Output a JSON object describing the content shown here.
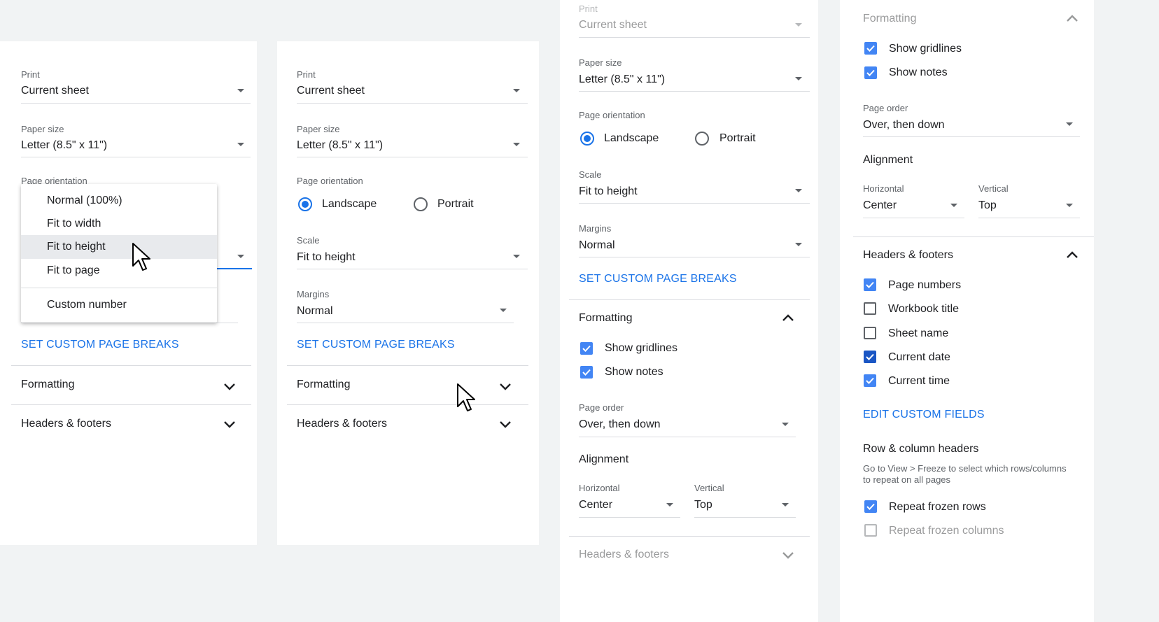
{
  "panel1": {
    "print_label": "Print",
    "print_value": "Current sheet",
    "paper_label": "Paper size",
    "paper_value": "Letter (8.5\" x 11\")",
    "orientation_label": "Page orientation",
    "scale_menu": {
      "items": [
        "Normal (100%)",
        "Fit to width",
        "Fit to height",
        "Fit to page",
        "Custom number"
      ],
      "highlighted": "Fit to height"
    },
    "set_breaks": "SET CUSTOM PAGE BREAKS",
    "formatting": "Formatting",
    "headers_footers": "Headers & footers"
  },
  "panel2": {
    "print_label": "Print",
    "print_value": "Current sheet",
    "paper_label": "Paper size",
    "paper_value": "Letter (8.5\" x 11\")",
    "orientation_label": "Page orientation",
    "landscape": "Landscape",
    "portrait": "Portrait",
    "scale_label": "Scale",
    "scale_value": "Fit to height",
    "margins_label": "Margins",
    "margins_value": "Normal",
    "set_breaks": "SET CUSTOM PAGE BREAKS",
    "formatting": "Formatting",
    "headers_footers": "Headers & footers"
  },
  "panel3": {
    "print_label": "Print",
    "print_value": "Current sheet",
    "paper_label": "Paper size",
    "paper_value": "Letter (8.5\" x 11\")",
    "orientation_label": "Page orientation",
    "landscape": "Landscape",
    "portrait": "Portrait",
    "scale_label": "Scale",
    "scale_value": "Fit to height",
    "margins_label": "Margins",
    "margins_value": "Normal",
    "set_breaks": "SET CUSTOM PAGE BREAKS",
    "formatting": "Formatting",
    "show_gridlines": "Show gridlines",
    "show_notes": "Show notes",
    "page_order_label": "Page order",
    "page_order_value": "Over, then down",
    "alignment": "Alignment",
    "horizontal_label": "Horizontal",
    "horizontal_value": "Center",
    "vertical_label": "Vertical",
    "vertical_value": "Top",
    "headers_footers": "Headers & footers"
  },
  "panel4": {
    "formatting": "Formatting",
    "show_gridlines": "Show gridlines",
    "show_notes": "Show notes",
    "page_order_label": "Page order",
    "page_order_value": "Over, then down",
    "alignment": "Alignment",
    "horizontal_label": "Horizontal",
    "horizontal_value": "Center",
    "vertical_label": "Vertical",
    "vertical_value": "Top",
    "headers_footers": "Headers & footers",
    "page_numbers": "Page numbers",
    "workbook_title": "Workbook title",
    "sheet_name": "Sheet name",
    "current_date": "Current date",
    "current_time": "Current time",
    "edit_fields": "EDIT CUSTOM FIELDS",
    "row_col_headers": "Row & column headers",
    "row_col_help": "Go to View > Freeze to select which rows/columns",
    "row_col_help2": "to repeat on all pages",
    "repeat_rows": "Repeat frozen rows",
    "repeat_cols": "Repeat frozen columns"
  },
  "colors": {
    "accent": "#1a73e8",
    "checkbox": "#4285f4",
    "background": "#f1f3f4"
  },
  "icons": [
    "dropdown-caret-icon",
    "chevron-down-icon",
    "chevron-up-icon",
    "checkbox-check-icon",
    "mouse-pointer-icon"
  ]
}
